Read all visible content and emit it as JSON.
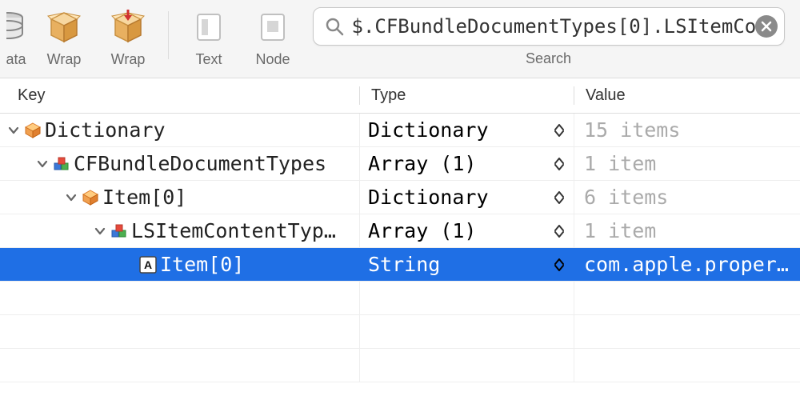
{
  "toolbar": {
    "items": [
      {
        "label": "ata"
      },
      {
        "label": "Wrap"
      },
      {
        "label": "Wrap"
      },
      {
        "label": "Text"
      },
      {
        "label": "Node"
      }
    ]
  },
  "search": {
    "value": "$.CFBundleDocumentTypes[0].LSItemCo",
    "label": "Search"
  },
  "columns": {
    "key": "Key",
    "type": "Type",
    "value": "Value"
  },
  "rows": [
    {
      "indent": 0,
      "disclosure": true,
      "icon": "box-orange",
      "key": "Dictionary",
      "type": "Dictionary",
      "value": "15 items",
      "selected": false
    },
    {
      "indent": 1,
      "disclosure": true,
      "icon": "blocks",
      "key": "CFBundleDocumentTypes",
      "type": "Array (1)",
      "value": "1 item",
      "selected": false
    },
    {
      "indent": 2,
      "disclosure": true,
      "icon": "box-orange",
      "key": "Item[0]",
      "type": "Dictionary",
      "value": "6 items",
      "selected": false
    },
    {
      "indent": 3,
      "disclosure": true,
      "icon": "blocks",
      "key": "LSItemContentTyp…",
      "type": "Array (1)",
      "value": "1 item",
      "selected": false
    },
    {
      "indent": 4,
      "disclosure": false,
      "icon": "string",
      "key": "Item[0]",
      "type": "String",
      "value": "com.apple.proper…",
      "selected": true
    }
  ]
}
